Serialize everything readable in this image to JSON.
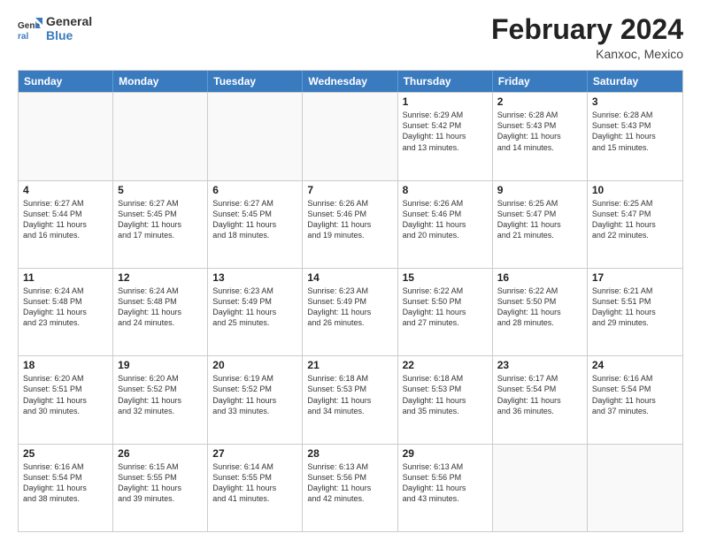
{
  "header": {
    "logo_general": "General",
    "logo_blue": "Blue",
    "month_year": "February 2024",
    "location": "Kanxoc, Mexico"
  },
  "weekdays": [
    "Sunday",
    "Monday",
    "Tuesday",
    "Wednesday",
    "Thursday",
    "Friday",
    "Saturday"
  ],
  "rows": [
    [
      {
        "day": "",
        "info": ""
      },
      {
        "day": "",
        "info": ""
      },
      {
        "day": "",
        "info": ""
      },
      {
        "day": "",
        "info": ""
      },
      {
        "day": "1",
        "info": "Sunrise: 6:29 AM\nSunset: 5:42 PM\nDaylight: 11 hours\nand 13 minutes."
      },
      {
        "day": "2",
        "info": "Sunrise: 6:28 AM\nSunset: 5:43 PM\nDaylight: 11 hours\nand 14 minutes."
      },
      {
        "day": "3",
        "info": "Sunrise: 6:28 AM\nSunset: 5:43 PM\nDaylight: 11 hours\nand 15 minutes."
      }
    ],
    [
      {
        "day": "4",
        "info": "Sunrise: 6:27 AM\nSunset: 5:44 PM\nDaylight: 11 hours\nand 16 minutes."
      },
      {
        "day": "5",
        "info": "Sunrise: 6:27 AM\nSunset: 5:45 PM\nDaylight: 11 hours\nand 17 minutes."
      },
      {
        "day": "6",
        "info": "Sunrise: 6:27 AM\nSunset: 5:45 PM\nDaylight: 11 hours\nand 18 minutes."
      },
      {
        "day": "7",
        "info": "Sunrise: 6:26 AM\nSunset: 5:46 PM\nDaylight: 11 hours\nand 19 minutes."
      },
      {
        "day": "8",
        "info": "Sunrise: 6:26 AM\nSunset: 5:46 PM\nDaylight: 11 hours\nand 20 minutes."
      },
      {
        "day": "9",
        "info": "Sunrise: 6:25 AM\nSunset: 5:47 PM\nDaylight: 11 hours\nand 21 minutes."
      },
      {
        "day": "10",
        "info": "Sunrise: 6:25 AM\nSunset: 5:47 PM\nDaylight: 11 hours\nand 22 minutes."
      }
    ],
    [
      {
        "day": "11",
        "info": "Sunrise: 6:24 AM\nSunset: 5:48 PM\nDaylight: 11 hours\nand 23 minutes."
      },
      {
        "day": "12",
        "info": "Sunrise: 6:24 AM\nSunset: 5:48 PM\nDaylight: 11 hours\nand 24 minutes."
      },
      {
        "day": "13",
        "info": "Sunrise: 6:23 AM\nSunset: 5:49 PM\nDaylight: 11 hours\nand 25 minutes."
      },
      {
        "day": "14",
        "info": "Sunrise: 6:23 AM\nSunset: 5:49 PM\nDaylight: 11 hours\nand 26 minutes."
      },
      {
        "day": "15",
        "info": "Sunrise: 6:22 AM\nSunset: 5:50 PM\nDaylight: 11 hours\nand 27 minutes."
      },
      {
        "day": "16",
        "info": "Sunrise: 6:22 AM\nSunset: 5:50 PM\nDaylight: 11 hours\nand 28 minutes."
      },
      {
        "day": "17",
        "info": "Sunrise: 6:21 AM\nSunset: 5:51 PM\nDaylight: 11 hours\nand 29 minutes."
      }
    ],
    [
      {
        "day": "18",
        "info": "Sunrise: 6:20 AM\nSunset: 5:51 PM\nDaylight: 11 hours\nand 30 minutes."
      },
      {
        "day": "19",
        "info": "Sunrise: 6:20 AM\nSunset: 5:52 PM\nDaylight: 11 hours\nand 32 minutes."
      },
      {
        "day": "20",
        "info": "Sunrise: 6:19 AM\nSunset: 5:52 PM\nDaylight: 11 hours\nand 33 minutes."
      },
      {
        "day": "21",
        "info": "Sunrise: 6:18 AM\nSunset: 5:53 PM\nDaylight: 11 hours\nand 34 minutes."
      },
      {
        "day": "22",
        "info": "Sunrise: 6:18 AM\nSunset: 5:53 PM\nDaylight: 11 hours\nand 35 minutes."
      },
      {
        "day": "23",
        "info": "Sunrise: 6:17 AM\nSunset: 5:54 PM\nDaylight: 11 hours\nand 36 minutes."
      },
      {
        "day": "24",
        "info": "Sunrise: 6:16 AM\nSunset: 5:54 PM\nDaylight: 11 hours\nand 37 minutes."
      }
    ],
    [
      {
        "day": "25",
        "info": "Sunrise: 6:16 AM\nSunset: 5:54 PM\nDaylight: 11 hours\nand 38 minutes."
      },
      {
        "day": "26",
        "info": "Sunrise: 6:15 AM\nSunset: 5:55 PM\nDaylight: 11 hours\nand 39 minutes."
      },
      {
        "day": "27",
        "info": "Sunrise: 6:14 AM\nSunset: 5:55 PM\nDaylight: 11 hours\nand 41 minutes."
      },
      {
        "day": "28",
        "info": "Sunrise: 6:13 AM\nSunset: 5:56 PM\nDaylight: 11 hours\nand 42 minutes."
      },
      {
        "day": "29",
        "info": "Sunrise: 6:13 AM\nSunset: 5:56 PM\nDaylight: 11 hours\nand 43 minutes."
      },
      {
        "day": "",
        "info": ""
      },
      {
        "day": "",
        "info": ""
      }
    ]
  ]
}
